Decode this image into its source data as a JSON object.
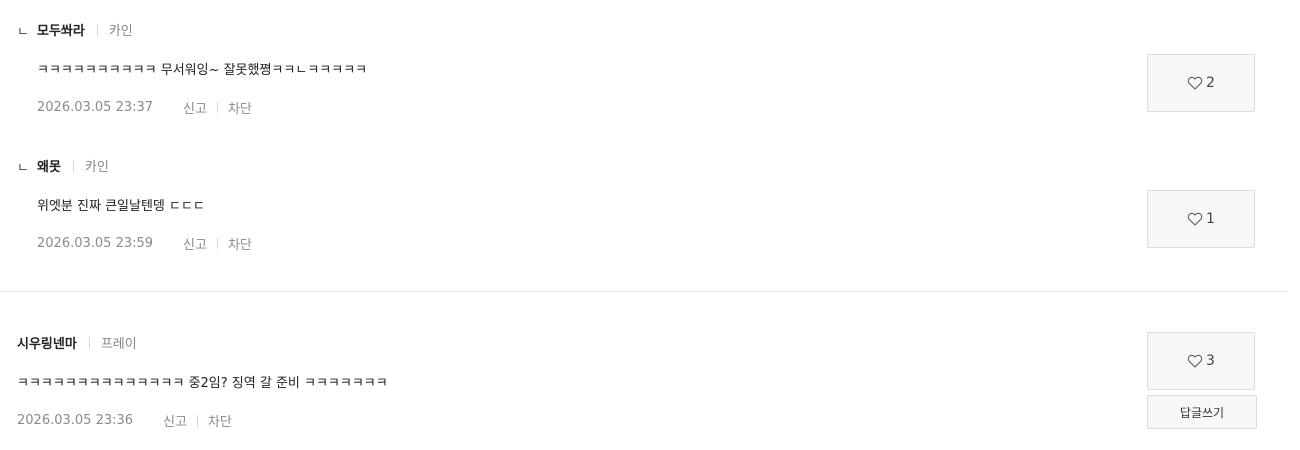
{
  "comments": [
    {
      "reply_marker": "ㄴ",
      "author": "모두쏴라",
      "badge": "카인",
      "text": "ㅋㅋㅋㅋㅋㅋㅋㅋㅋㅋ 무서워잉~ 잘못했쪙ㅋㅋㄴㅋㅋㅋㅋㅋ",
      "date": "2026.03.05 23:37",
      "report_label": "신고",
      "block_label": "차단",
      "likes": "2"
    },
    {
      "reply_marker": "ㄴ",
      "author": "왜못",
      "badge": "카인",
      "text": "위엣분 진짜 큰일날텐뎅 ㄷㄷㄷ",
      "date": "2026.03.05 23:59",
      "report_label": "신고",
      "block_label": "차단",
      "likes": "1"
    },
    {
      "author": "시우링넨마",
      "badge": "프레이",
      "text": "ㅋㅋㅋㅋㅋㅋㅋㅋㅋㅋㅋㅋㅋㅋ 중2임? 징역 갈 준비 ㅋㅋㅋㅋㅋㅋㅋ",
      "date": "2026.03.05 23:36",
      "report_label": "신고",
      "block_label": "차단",
      "likes": "3",
      "reply_button_label": "답글쓰기"
    }
  ],
  "colors": {
    "heart_stroke": "#555555",
    "box_bg": "#f6f7f9",
    "border": "#dcdcdc"
  }
}
